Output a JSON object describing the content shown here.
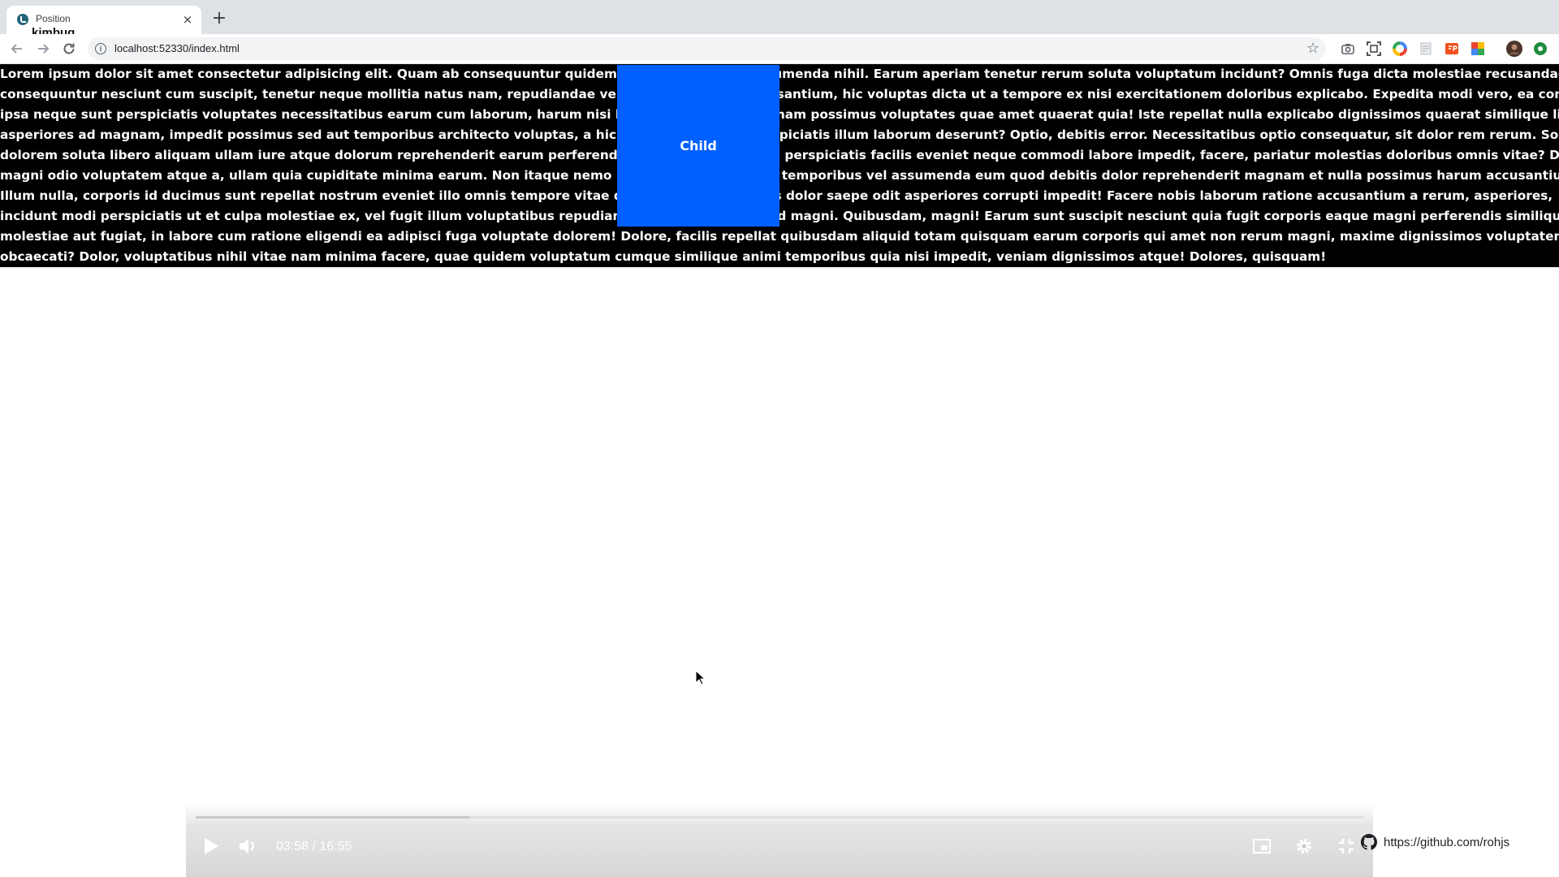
{
  "browser": {
    "tab": {
      "title": "Position",
      "close_glyph": "×",
      "favicon": "globe-icon"
    },
    "new_tab_glyph": "+",
    "overlay_user": "kimbug",
    "url": "localhost:52330/index.html",
    "info_glyph": "i",
    "star_glyph": "☆",
    "extensions": [
      "camera-icon",
      "screenshot-icon",
      "colorwheel-icon",
      "doc-icon",
      "fb-icon",
      "palette-icon",
      "profile-avatar",
      "status-icon"
    ]
  },
  "page": {
    "parent_lines": [
      "Lorem ipsum dolor sit amet consectetur adipisicing elit. Quam ab consequuntur quidem deleniti harum ad assumenda nihil. Earum aperiam tenetur rerum soluta voluptatum incidunt? Omnis fuga dicta molestiae recusandae officia praesentium nulla. Earum dolores",
      "consequuntur nesciunt cum suscipit, tenetur neque mollitia natus nam, repudiandae veritatis laboriosam accusantium, hic voluptas dicta ut a tempore ex nisi exercitationem doloribus explicabo. Expedita modi vero, ea consectetur",
      "ipsa neque sunt perspiciatis voluptates necessitatibus earum cum laborum, harum nisi laborio. Sit dolore magnam possimus voluptates quae amet quaerat quia! Iste repellat nulla explicabo dignissimos quaerat similique libero facere culpa optio provident",
      "asperiores ad magnam, impedit possimus sed aut temporibus architecto voluptas, a hic tempore nesciunt perspiciatis illum laborum deserunt? Optio, debitis error. Necessitatibus optio consequatur, sit dolor rem rerum. Soluta, vitae! At ipsa pariatur, esse",
      "dolorem soluta libero aliquam ullam iure atque dolorum reprehenderit earum perferendis! Accusamus nostrum perspiciatis facilis eveniet neque commodi labore impedit, facere, pariatur molestias doloribus omnis vitae? Debitis id eius, aut,",
      "magni odio voluptatem atque a, ullam quia cupiditate minima earum. Non itaque nemo rem, repellat doloribus temporibus vel assumenda eum quod debitis dolor reprehenderit magnam et nulla possimus harum accusantium deleniti sunt!",
      "Illum nulla, corporis id ducimus sunt repellat nostrum eveniet illo omnis tempore vitae quidem ea blanditiis dis dolor saepe odit asperiores corrupti impedit! Facere nobis laborum ratione accusantium a rerum, asperiores,",
      "incidunt modi perspiciatis ut et culpa molestiae ex, vel fugit illum voluptatibus repudiandae. Esse ipsam aliquid magni. Quibusdam, magni! Earum sunt suscipit nesciunt quia fugit corporis eaque magni perferendis similique",
      "molestiae aut fugiat, in labore cum ratione eligendi ea adipisci fuga voluptate dolorem! Dolore, facilis repellat quibusdam aliquid totam quisquam earum corporis qui amet non rerum magni, maxime dignissimos voluptatem libero",
      "obcaecati? Dolor, voluptatibus nihil vitae nam minima facere, quae quidem voluptatum cumque similique animi temporibus quia nisi impedit, veniam dignissimos atque! Dolores, quisquam!"
    ],
    "child_label": "Child",
    "colors": {
      "parent_bg": "#000000",
      "child_bg": "#0060ff",
      "text": "#ffffff"
    }
  },
  "player": {
    "time": "03:58 / 16:55",
    "progress": 0.235,
    "controls": [
      "play-icon",
      "volume-icon",
      "miniplayer-icon",
      "settings-icon",
      "exit-fullscreen-icon"
    ]
  },
  "github": {
    "text": "https://github.com/rohjs",
    "icon": "github-icon"
  }
}
